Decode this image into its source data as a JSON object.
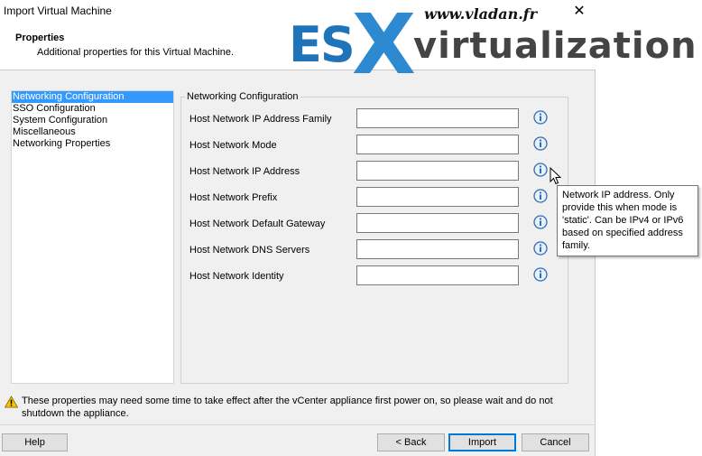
{
  "window": {
    "title": "Import Virtual Machine",
    "close_glyph": "✕"
  },
  "header": {
    "title": "Properties",
    "subtitle": "Additional properties for this Virtual Machine."
  },
  "watermark": {
    "url": "www.vladan.fr",
    "es": "ES",
    "x": "X",
    "virtualization": "virtualization"
  },
  "nav": {
    "items": [
      {
        "label": "Networking Configuration",
        "selected": true
      },
      {
        "label": "SSO Configuration",
        "selected": false
      },
      {
        "label": "System Configuration",
        "selected": false
      },
      {
        "label": "Miscellaneous",
        "selected": false
      },
      {
        "label": "Networking Properties",
        "selected": false
      }
    ]
  },
  "panel": {
    "legend": "Networking Configuration",
    "rows": [
      {
        "label": "Host Network IP Address Family",
        "value": ""
      },
      {
        "label": "Host Network Mode",
        "value": ""
      },
      {
        "label": "Host Network IP Address",
        "value": ""
      },
      {
        "label": "Host Network Prefix",
        "value": ""
      },
      {
        "label": "Host Network Default Gateway",
        "value": ""
      },
      {
        "label": "Host Network DNS Servers",
        "value": ""
      },
      {
        "label": "Host Network Identity",
        "value": ""
      }
    ]
  },
  "tooltip": {
    "text": "Network IP address.  Only provide this when mode is 'static'.  Can be IPv4 or IPv6 based on specified address family."
  },
  "warning": {
    "text": "These properties may need some time to take effect after the vCenter appliance first power on, so please wait and do not shutdown the appliance."
  },
  "buttons": {
    "help": "Help",
    "back": "< Back",
    "import": "Import",
    "cancel": "Cancel"
  },
  "colors": {
    "selection": "#3399ff",
    "info_icon": "#2f6db5",
    "warning": "#f5c400",
    "watermark_blue": "#1f74b9"
  },
  "icons": {
    "info": "info-icon",
    "warning": "warning-icon",
    "cursor": "mouse-pointer-icon"
  }
}
